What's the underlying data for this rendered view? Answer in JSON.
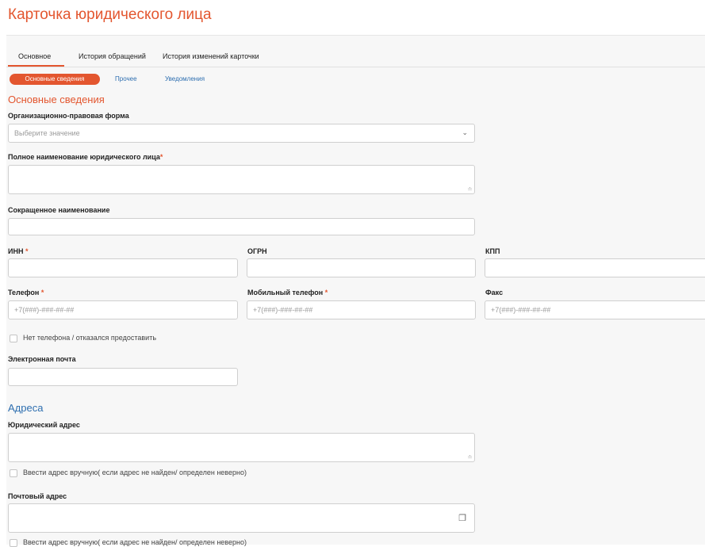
{
  "page_title": "Карточка юридического лица",
  "tabs": [
    "Основное",
    "История обращений",
    "История изменений карточки"
  ],
  "subtabs": [
    "Основные сведения",
    "Прочее",
    "Уведомления"
  ],
  "colors": {
    "accent": "#e3562f",
    "link": "#2e6fb0"
  },
  "section_main": "Основные сведения",
  "org_form": {
    "label": "Организационно-правовая форма",
    "placeholder": "Выберите значение"
  },
  "full_name": {
    "label": "Полное наименование юридического лица",
    "required_mark": "*"
  },
  "short_name": {
    "label": "Сокращенное наименование"
  },
  "inn": {
    "label": "ИНН",
    "required_mark": "*"
  },
  "ogrn": {
    "label": "ОГРН"
  },
  "kpp": {
    "label": "КПП"
  },
  "phone": {
    "label": "Телефон",
    "required_mark": "*",
    "placeholder": "+7(###)-###-##-##"
  },
  "mobile": {
    "label": "Мобильный телефон",
    "required_mark": "*",
    "placeholder": "+7(###)-###-##-##"
  },
  "fax": {
    "label": "Факс",
    "placeholder": "+7(###)-###-##-##"
  },
  "no_phone": "Нет телефона / отказался предоставить",
  "email": {
    "label": "Электронная почта"
  },
  "section_addresses": "Адреса",
  "legal_address": {
    "label": "Юридический адрес",
    "manual": "Ввести адрес вручную( если адрес не найден/ определен неверно)"
  },
  "postal_address": {
    "label": "Почтовый адрес",
    "manual": "Ввести адрес вручную( если адрес не найден/ определен неверно)"
  }
}
